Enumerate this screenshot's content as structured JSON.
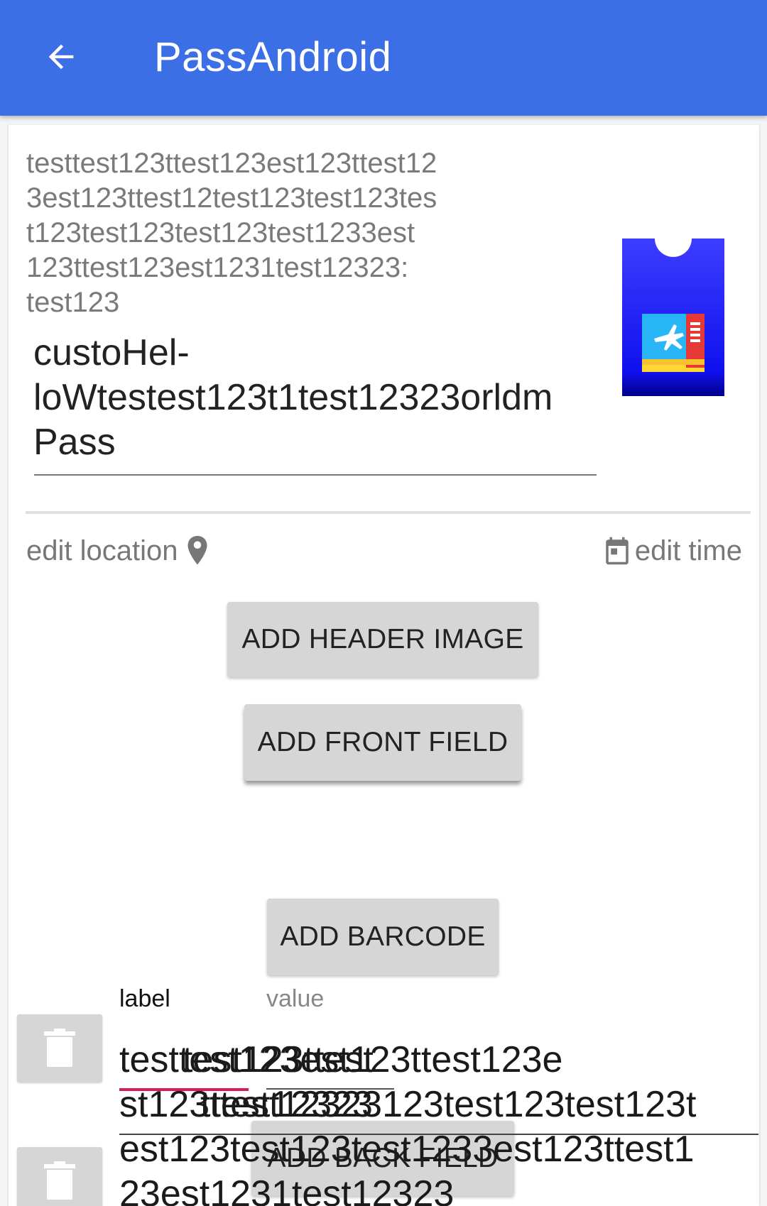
{
  "appbar": {
    "title": "PassAndroid",
    "back_icon": "arrow-back-icon",
    "color": "#3c6ee6"
  },
  "pass": {
    "description_lines": [
      "testtest123ttest123est123ttest12",
      "3est123ttest12test123test123tes",
      "t123test123test123test1233est",
      "123ttest123est1231test12323:",
      "test123"
    ],
    "name_lines": [
      "custoHel-",
      "loWtestest123t1test12323orldm",
      "Pass"
    ],
    "icon": "boarding-pass-icon"
  },
  "actions": {
    "edit_location": "edit location",
    "edit_location_icon": "map-pin-icon",
    "edit_time": "edit time",
    "edit_time_icon": "calendar-icon"
  },
  "buttons": {
    "add_header_image": "ADD HEADER IMAGE",
    "add_front_field": "ADD FRONT FIELD",
    "add_barcode": "ADD BARCODE",
    "add_back_field": "ADD BACK FIELD"
  },
  "field": {
    "label_caption": "label",
    "value_caption": "value",
    "label_text": "testtest123",
    "value_lines": [
      "testtest123est123ttest123e",
      "st123ttest12323123test123test123t",
      "est123test123test1233est123ttest1",
      "23est1231test12323"
    ],
    "overlap_label_line1": "test123ttest",
    "overlap_label_line2": "ttest12323",
    "delete_icon": "trash-icon"
  },
  "colors": {
    "accent": "#d81b60",
    "button_bg": "#d6d6d6"
  }
}
